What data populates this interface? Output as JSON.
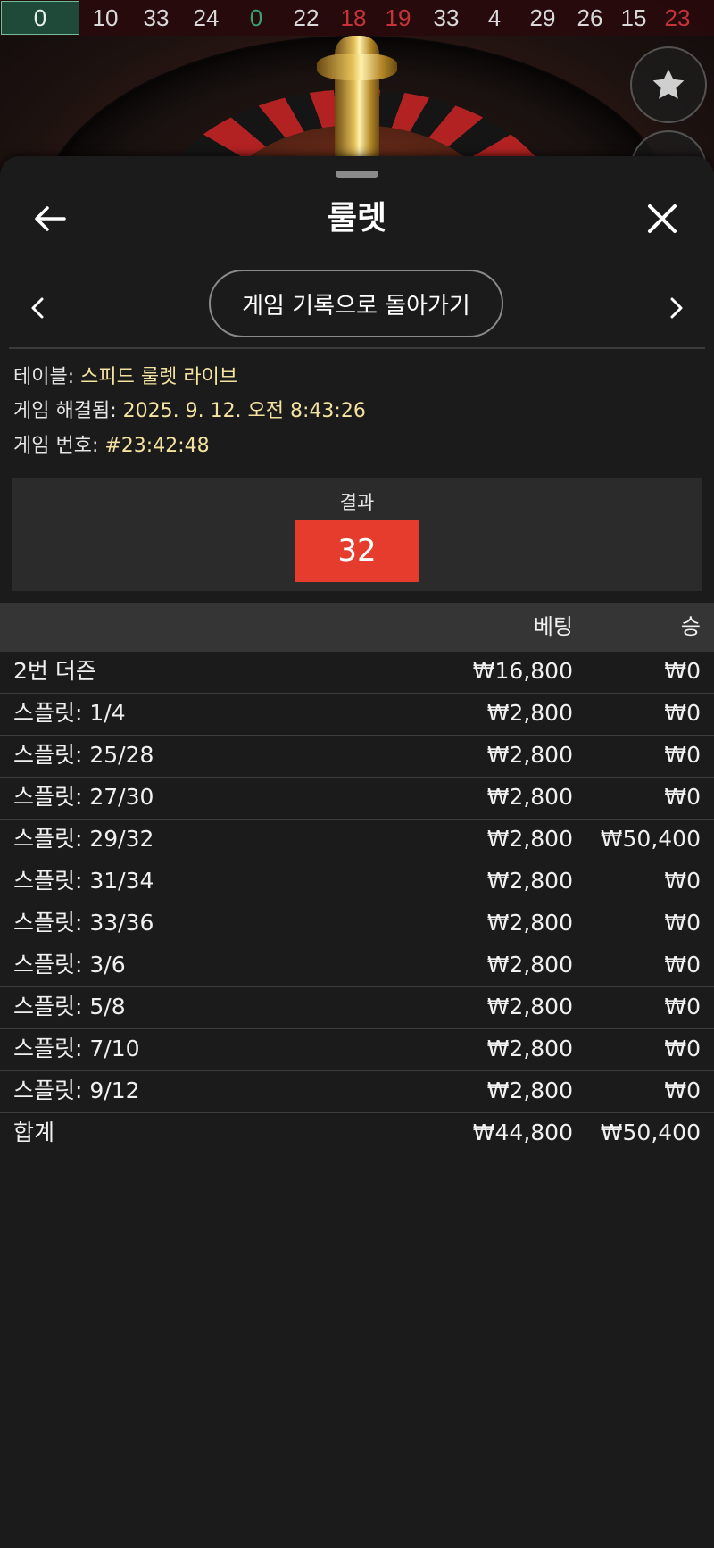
{
  "history_bar": {
    "numbers": [
      {
        "value": "0",
        "color": "green-boxed"
      },
      {
        "value": "10",
        "color": "black"
      },
      {
        "value": "33",
        "color": "black"
      },
      {
        "value": "24",
        "color": "black"
      },
      {
        "value": "0",
        "color": "green"
      },
      {
        "value": "22",
        "color": "black"
      },
      {
        "value": "18",
        "color": "red"
      },
      {
        "value": "19",
        "color": "red"
      },
      {
        "value": "33",
        "color": "black"
      },
      {
        "value": "4",
        "color": "black"
      },
      {
        "value": "29",
        "color": "black"
      },
      {
        "value": "26",
        "color": "black"
      },
      {
        "value": "15",
        "color": "black"
      },
      {
        "value": "23",
        "color": "red"
      }
    ]
  },
  "icons": {
    "favorite": "star-icon",
    "back": "arrow-left-icon",
    "close": "close-icon",
    "prev": "chevron-left-icon",
    "next": "chevron-right-icon"
  },
  "sheet": {
    "title": "룰렛",
    "back_to_history_label": "게임 기록으로 돌아가기"
  },
  "info": {
    "table_label": "테이블:",
    "table_value": "스피드 룰렛 라이브",
    "resolved_label": "게임 해결됨:",
    "resolved_value": "2025. 9. 12. 오전 8:43:26",
    "game_no_label": "게임 번호:",
    "game_no_value": "#23:42:48"
  },
  "result": {
    "label": "결과",
    "number": "32",
    "color": "#e53c2e"
  },
  "bets_table": {
    "columns": [
      "",
      "베팅",
      "승"
    ],
    "rows": [
      {
        "name": "2번 더즌",
        "bet": "₩16,800",
        "win": "₩0"
      },
      {
        "name": "스플릿: 1/4",
        "bet": "₩2,800",
        "win": "₩0"
      },
      {
        "name": "스플릿: 25/28",
        "bet": "₩2,800",
        "win": "₩0"
      },
      {
        "name": "스플릿: 27/30",
        "bet": "₩2,800",
        "win": "₩0"
      },
      {
        "name": "스플릿: 29/32",
        "bet": "₩2,800",
        "win": "₩50,400"
      },
      {
        "name": "스플릿: 31/34",
        "bet": "₩2,800",
        "win": "₩0"
      },
      {
        "name": "스플릿: 33/36",
        "bet": "₩2,800",
        "win": "₩0"
      },
      {
        "name": "스플릿: 3/6",
        "bet": "₩2,800",
        "win": "₩0"
      },
      {
        "name": "스플릿: 5/8",
        "bet": "₩2,800",
        "win": "₩0"
      },
      {
        "name": "스플릿: 7/10",
        "bet": "₩2,800",
        "win": "₩0"
      },
      {
        "name": "스플릿: 9/12",
        "bet": "₩2,800",
        "win": "₩0"
      }
    ],
    "total": {
      "name": "합계",
      "bet": "₩44,800",
      "win": "₩50,400"
    }
  }
}
